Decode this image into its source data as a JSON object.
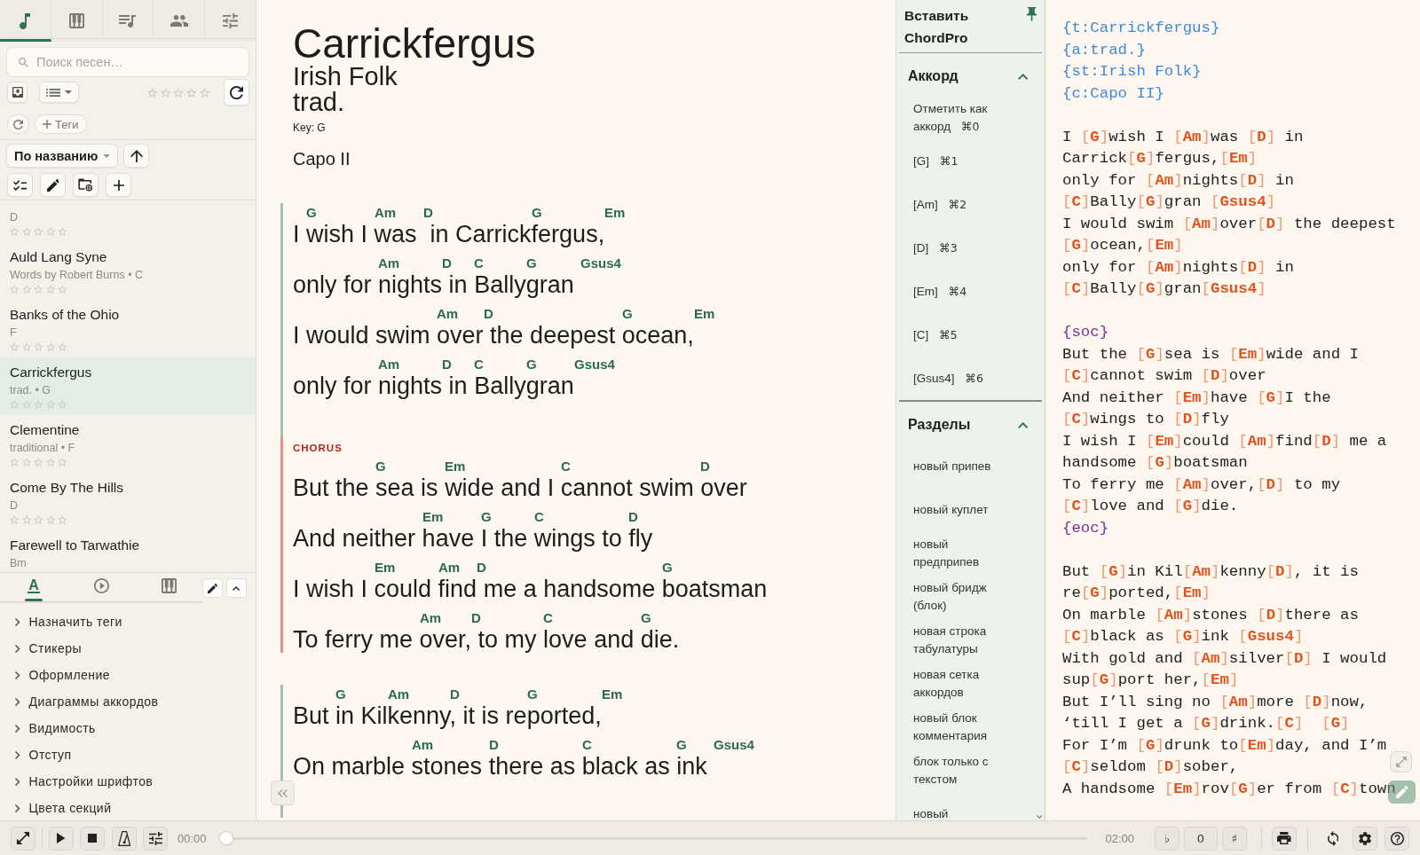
{
  "sidebar": {
    "nav_tabs": [
      {
        "kind": "note",
        "selected": true
      },
      {
        "kind": "piano",
        "selected": false
      },
      {
        "kind": "playlist",
        "selected": false
      },
      {
        "kind": "people",
        "selected": false
      },
      {
        "kind": "sliders",
        "selected": false
      }
    ],
    "search": {
      "placeholder": "Поиск песен…"
    },
    "rating_filter": {
      "stars": 0
    },
    "tags_button": "Теги",
    "sort_button": "По названию",
    "songs": [
      {
        "subtitle": "D",
        "stars": 0,
        "selected": false
      },
      {
        "title": "Auld Lang Syne",
        "subtitle": "Words by Robert Burns • C",
        "stars": 0,
        "selected": false
      },
      {
        "title": "Banks of the Ohio",
        "subtitle": "F",
        "stars": 0,
        "selected": false
      },
      {
        "title": "Carrickfergus",
        "subtitle": "trad. • G",
        "stars": 0,
        "selected": true
      },
      {
        "title": "Clementine",
        "subtitle": "traditional • F",
        "stars": 0,
        "selected": false
      },
      {
        "title": "Come By The Hills",
        "subtitle": "D",
        "stars": 0,
        "selected": false
      },
      {
        "title": "Farewell to Tarwathie",
        "subtitle": "Bm",
        "selected": false
      }
    ],
    "panel_tabs": [
      {
        "kind": "text",
        "label": "A",
        "selected": true
      },
      {
        "kind": "player",
        "selected": false
      },
      {
        "kind": "piano",
        "selected": false
      }
    ],
    "options": [
      {
        "label": "Назначить теги",
        "expanded": false
      },
      {
        "label": "Стикеры",
        "expanded": false
      },
      {
        "label": "Оформление",
        "expanded": false
      },
      {
        "label": "Диаграммы аккордов",
        "expanded": false
      },
      {
        "label": "Видимость",
        "expanded": false
      },
      {
        "label": "Отступ",
        "expanded": false
      },
      {
        "label": "Настройки шрифтов",
        "expanded": false
      },
      {
        "label": "Цвета секций",
        "expanded": false
      }
    ]
  },
  "song": {
    "title": "Carrickfergus",
    "subtitle": "Irish Folk",
    "artist": "trad.",
    "key": "Key: G",
    "comment": "Capo II",
    "sections": [
      {
        "kind": "verse",
        "lines": [
          [
            {
              "text": "I "
            },
            {
              "chord": "G",
              "text": "wish I "
            },
            {
              "chord": "Am",
              "text": "was "
            },
            {
              "chord": "D",
              "text": " in Carrick"
            },
            {
              "chord": "G",
              "text": "fergus,"
            },
            {
              "chord": "Em"
            }
          ],
          [
            {
              "text": "only for "
            },
            {
              "chord": "Am",
              "text": "nights"
            },
            {
              "chord": "D",
              "text": " in "
            },
            {
              "chord": "C",
              "text": "Bally"
            },
            {
              "chord": "G",
              "text": "gran "
            },
            {
              "chord": "Gsus4"
            }
          ],
          [
            {
              "text": "I would swim "
            },
            {
              "chord": "Am",
              "text": "over"
            },
            {
              "chord": "D",
              "text": " the deepest "
            },
            {
              "chord": "G",
              "text": "ocean,"
            },
            {
              "chord": "Em"
            }
          ],
          [
            {
              "text": "only for "
            },
            {
              "chord": "Am",
              "text": "nights"
            },
            {
              "chord": "D",
              "text": " in "
            },
            {
              "chord": "C",
              "text": "Bally"
            },
            {
              "chord": "G",
              "text": "gran"
            },
            {
              "chord": "Gsus4"
            }
          ]
        ]
      },
      {
        "kind": "chorus",
        "label": "CHORUS",
        "lines": [
          [
            {
              "text": "But the "
            },
            {
              "chord": "G",
              "text": "sea is "
            },
            {
              "chord": "Em",
              "text": "wide and I "
            },
            {
              "chord": "C",
              "text": "cannot swim "
            },
            {
              "chord": "D",
              "text": "over"
            }
          ],
          [
            {
              "text": "And neither "
            },
            {
              "chord": "Em",
              "text": "have "
            },
            {
              "chord": "G",
              "text": "I the "
            },
            {
              "chord": "C",
              "text": "wings to "
            },
            {
              "chord": "D",
              "text": "fly"
            }
          ],
          [
            {
              "text": "I wish I "
            },
            {
              "chord": "Em",
              "text": "could "
            },
            {
              "chord": "Am",
              "text": "find"
            },
            {
              "chord": "D",
              "text": " me a handsome "
            },
            {
              "chord": "G",
              "text": "boatsman"
            }
          ],
          [
            {
              "text": "To ferry me "
            },
            {
              "chord": "Am",
              "text": "over,"
            },
            {
              "chord": "D",
              "text": " to my "
            },
            {
              "chord": "C",
              "text": "love and "
            },
            {
              "chord": "G",
              "text": "die."
            }
          ]
        ]
      },
      {
        "kind": "verse",
        "lines": [
          [
            {
              "text": "But "
            },
            {
              "chord": "G",
              "text": "in Kil"
            },
            {
              "chord": "Am",
              "text": "kenny"
            },
            {
              "chord": "D",
              "text": ", it is re"
            },
            {
              "chord": "G",
              "text": "ported,"
            },
            {
              "chord": "Em"
            }
          ],
          [
            {
              "text": "On marble "
            },
            {
              "chord": "Am",
              "text": "stones "
            },
            {
              "chord": "D",
              "text": "there as "
            },
            {
              "chord": "C",
              "text": "black as "
            },
            {
              "chord": "G",
              "text": "ink "
            },
            {
              "chord": "Gsus4"
            }
          ]
        ]
      }
    ]
  },
  "insert_panel": {
    "title": "Вставить ChordPro",
    "groups": [
      {
        "title": "Аккорд",
        "expanded": true,
        "items": [
          {
            "label": "Отметить как аккорд",
            "shortcut": "⌘0"
          },
          {
            "label": "[G]",
            "shortcut": "⌘1"
          },
          {
            "label": "[Am]",
            "shortcut": "⌘2"
          },
          {
            "label": "[D]",
            "shortcut": "⌘3"
          },
          {
            "label": "[Em]",
            "shortcut": "⌘4"
          },
          {
            "label": "[C]",
            "shortcut": "⌘5"
          },
          {
            "label": "[Gsus4]",
            "shortcut": "⌘6"
          }
        ]
      },
      {
        "title": "Разделы",
        "expanded": true,
        "items": [
          {
            "label": "новый припев"
          },
          {
            "label": "новый куплет"
          },
          {
            "label": "новый предприпев"
          },
          {
            "label": "новый бридж (блок)"
          },
          {
            "label": "новая строка табулатуры"
          },
          {
            "label": "новая сетка аккордов"
          },
          {
            "label": "новый блок комментария"
          },
          {
            "label": "блок только с текстом"
          },
          {
            "label": "новый"
          }
        ]
      }
    ]
  },
  "editor": {
    "blocks": [
      [
        "{t:Carrickfergus}",
        "{a:trad.}",
        "{st:Irish Folk}",
        "{c:Capo II}"
      ],
      [
        "I [G]wish I [Am]was [D] in",
        "Carrick[G]fergus,[Em]",
        "only for [Am]nights[D] in",
        "[C]Bally[G]gran [Gsus4]",
        "I would swim [Am]over[D] the deepest",
        "[G]ocean,[Em]",
        "only for [Am]nights[D] in",
        "[C]Bally[G]gran[Gsus4]"
      ],
      [
        "{soc}",
        "But the [G]sea is [Em]wide and I",
        "[C]cannot swim [D]over",
        "And neither [Em]have [G]I the",
        "[C]wings to [D]fly",
        "I wish I [Em]could [Am]find[D] me a",
        "handsome [G]boatsman",
        "To ferry me [Am]over,[D] to my",
        "[C]love and [G]die.",
        "{eoc}"
      ],
      [
        "But [G]in Kil[Am]kenny[D], it is",
        "re[G]ported,[Em]",
        "On marble [Am]stones [D]there as",
        "[C]black as [G]ink [Gsus4]",
        "With gold and [Am]silver[D] I would",
        "sup[G]port her,[Em]",
        "But I’ll sing no [Am]more [D]now,",
        "‘till I get a [G]drink.[C]  [G]",
        "For I’m [G]drunk to[Em]day, and I’m",
        "[C]seldom [D]sober,",
        "A handsome [Em]rov[G]er from [C]town"
      ]
    ]
  },
  "player": {
    "elapsed": "00:00",
    "level": 0,
    "duration": "02:00",
    "transpose": [
      "♭",
      "0",
      "♯"
    ]
  }
}
